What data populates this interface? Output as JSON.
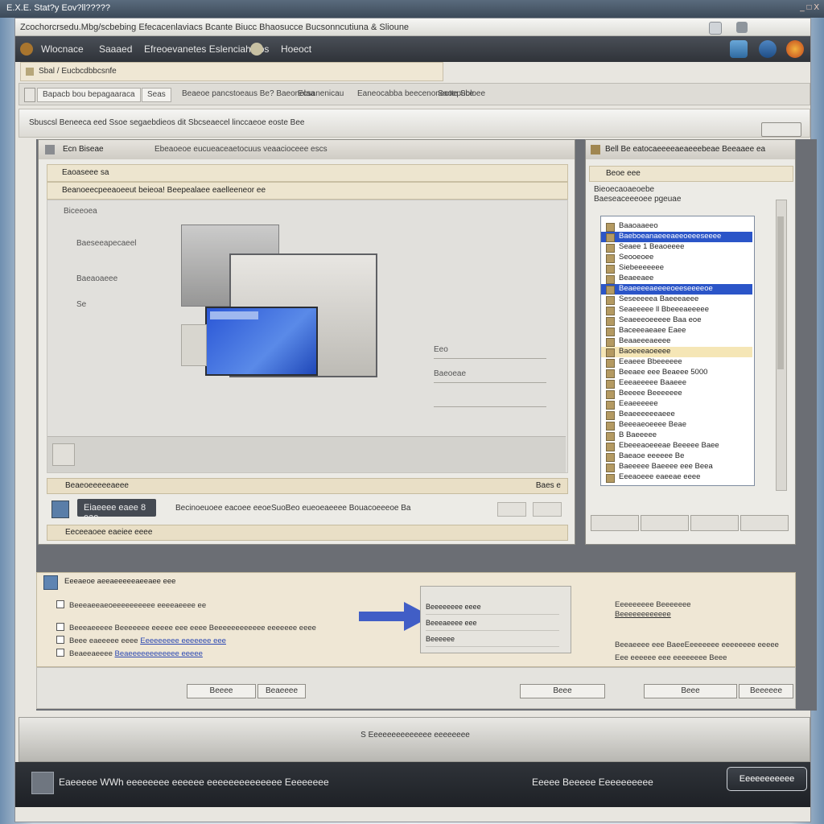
{
  "app": {
    "title": "E.X.E. Stat?y Eov?ll?????",
    "window_controls": "_ □ X"
  },
  "header": {
    "title": "Zcochorcrsedu.Mbg/scbebing Efecacenlaviacs Bcante Biucc Bhaosucce Bucsonncutiuna & Slioune"
  },
  "toolbar": {
    "item1": "Wlocnace",
    "item2": "Saaaed",
    "item3": "Efreoevanetes Eslenciaha os",
    "item4": "Hoeoct"
  },
  "address": {
    "text": "Sbal / Eucbcdbbcsnfe"
  },
  "tabs": [
    {
      "label": "Bapacb bou bepagaaraca"
    },
    {
      "label": "Seas"
    },
    {
      "label": "Beaeoe pancstoeaus Be? Baeonelaa"
    },
    {
      "label": "Ecsanenicau"
    },
    {
      "label": "Eaneocabba beecenoneotte Sbloee"
    },
    {
      "label": "Saoepuce"
    }
  ],
  "breadcrumb": {
    "text": "Sbuscsl Beneeca eed Ssoe segaebdieos dit Sbcseaecel linccaeoe eoste Bee"
  },
  "left_panel": {
    "title": "Ecn Biseae",
    "subtitle": "Ebeaoeoe eucueaceaetocuus veaacioceee escs",
    "strip1": "Eaoaseee sa",
    "strip2": "Beanoeecpeeaoeeut beieoa! Beepealaee eaelleeneor ee",
    "area_title": "Biceeoea",
    "label1": "Baeseeapecaeel",
    "label2": "Baeaoaeee",
    "label3": "Se",
    "field1": "Eeo",
    "field2": "Baeoeae",
    "section1": "Beaeoeeeeeaeee",
    "section1_right": "Baes e",
    "action_button": "Eiaeeee eaee 8 eae",
    "action_text": "Becinoeuoee eacoee eeoeSuoBeo eueoeaeeee Bouacoeeeoe Ba",
    "section2": "Eeceeaoee eaeiee eeee"
  },
  "right_panel": {
    "title": "Bell Be eatocaeeeeaeaeeebeae Beeaaee ea",
    "strip": "Beoe eee",
    "label1": "Bieoecaoaeoebe",
    "label2": "Baeseaceeeoee pgeuae",
    "list": [
      {
        "label": "Baaoaaeeo"
      },
      {
        "label": "Baeboeanaeeeaeeoeeeseeee",
        "state": "sel"
      },
      {
        "label": "Seaee 1 Beaoeeee"
      },
      {
        "label": "Seooeoee"
      },
      {
        "label": "Siebeeeeeee"
      },
      {
        "label": "Beaeeaee"
      },
      {
        "label": "Beaeeeeaeeeeoeeseeeeoe",
        "state": "sel"
      },
      {
        "label": "Seseeeeea Baeeeaeee"
      },
      {
        "label": "Seaeeeee ll Bbeeeaeeeee"
      },
      {
        "label": "Seaeeeoeeeee Baa eoe"
      },
      {
        "label": "Baceeeaeaee Eaee"
      },
      {
        "label": "Beaaeeeaeeee"
      },
      {
        "label": "Baoeeeaoeeee",
        "state": "hl"
      },
      {
        "label": "Eeaeee Bbeeeeee"
      },
      {
        "label": "Beeaee eee Beaeee 5000"
      },
      {
        "label": "Eeeaeeeee Baaeee"
      },
      {
        "label": "Beeeee Beeeeeee"
      },
      {
        "label": "Eeaeeeeee"
      },
      {
        "label": "Beaeeeeeeaeee"
      },
      {
        "label": "Beeeaeoeeee Beae"
      },
      {
        "label": "B Baeeeee"
      },
      {
        "label": "Ebeeeaoeeeae Beeeee Baee"
      },
      {
        "label": "Baeaoe eeeeee Be"
      },
      {
        "label": "Baeeeee Baeeee eee Beea"
      },
      {
        "label": "Eeeaoeee eaeeae eeee"
      }
    ]
  },
  "dialog": {
    "title": "Eeeaeoe aeeaeeeeeaeeaee eee",
    "opt1": "Beeeaeeaeoeeeeeeeeee eeeeaeeee ee",
    "opt2": "Beeeaeeeee Beeeeeee eeeee eee eeee Beeeeeeeeeeee eeeeeee eeee",
    "opt3": "Beee eaeeeee eeee",
    "opt3_link": "Eeeeeeeee eeeeeee eee",
    "opt4": "Beaeeaeeee",
    "opt4_link": "Beaeeeeeeeeeeee eeeee",
    "mini_rows": [
      "Beeeeeeee eeee",
      "Beeeaeeee eee",
      "Beeeeee"
    ],
    "right1": "Eeeeeeeee Beeeeeee",
    "right1_link": "Beeeeeeeeeeee",
    "right2": "Beeaeeee eee BaeeEeeeeeee eeeeeeee eeeee",
    "right3": "Eee eeeeee eee eeeeeeee Beee"
  },
  "buttons": {
    "b1": "Beeee",
    "b2": "Beaeeee",
    "b3": "Beee",
    "b4": "Beee",
    "b5": "Beeeeee"
  },
  "status_a": {
    "text": "S Eeeeeeeeeeeeee eeeeeeee"
  },
  "status_b": {
    "text1": "Eaeeeee WWh eeeeeeee eeeeee eeeeeeeeeeeeee Eeeeeeee",
    "text2": "Eeeee Beeeee Eeeeeeeeee",
    "button": "Eeeeeeeeeee"
  },
  "colors": {
    "accent_blue": "#2b55c8",
    "toolbar_dark": "#2f3339",
    "panel_beige": "#efe7d5"
  }
}
